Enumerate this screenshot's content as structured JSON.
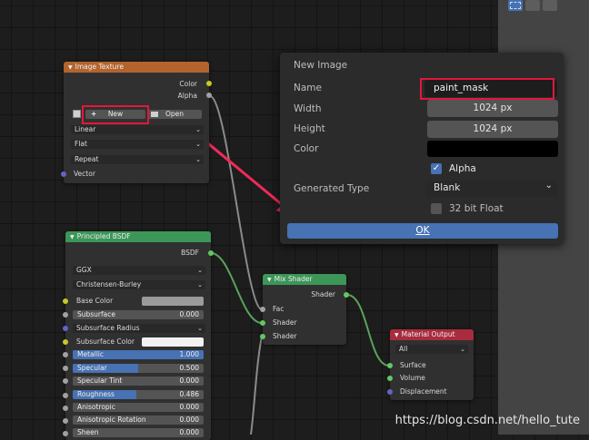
{
  "toolbar": {
    "tool_icons": [
      "select-box-icon",
      "extend-selection-icon",
      "subtract-selection-icon"
    ]
  },
  "image_texture": {
    "title": "Image Texture",
    "color_out": "Color",
    "alpha_out": "Alpha",
    "new_button": "New",
    "open_button": "Open",
    "interpolation": "Linear",
    "projection": "Flat",
    "extension": "Repeat",
    "vector_in": "Vector"
  },
  "principled": {
    "title": "Principled BSDF",
    "bsdf_out": "BSDF",
    "distribution": "GGX",
    "subsurface_method": "Christensen-Burley",
    "rows": [
      {
        "label": "Base Color",
        "value": ""
      },
      {
        "label": "Subsurface",
        "value": "0.000"
      },
      {
        "label": "Subsurface Radius",
        "value": ""
      },
      {
        "label": "Subsurface Color",
        "value": ""
      },
      {
        "label": "Metallic",
        "value": "1.000",
        "fill": 1.0
      },
      {
        "label": "Specular",
        "value": "0.500",
        "fill": 0.5
      },
      {
        "label": "Specular Tint",
        "value": "0.000",
        "fill": 0.0
      },
      {
        "label": "Roughness",
        "value": "0.486",
        "fill": 0.486
      },
      {
        "label": "Anisotropic",
        "value": "0.000"
      },
      {
        "label": "Anisotropic Rotation",
        "value": "0.000"
      },
      {
        "label": "Sheen",
        "value": "0.000"
      }
    ]
  },
  "mix_shader": {
    "title": "Mix Shader",
    "shader_out": "Shader",
    "fac": "Fac",
    "shader_in1": "Shader",
    "shader_in2": "Shader"
  },
  "material_output": {
    "title": "Material Output",
    "target": "All",
    "surface": "Surface",
    "volume": "Volume",
    "displacement": "Displacement"
  },
  "new_image_dialog": {
    "title": "New Image",
    "name_label": "Name",
    "name_value": "paint_mask",
    "width_label": "Width",
    "width_value": "1024 px",
    "height_label": "Height",
    "height_value": "1024 px",
    "color_label": "Color",
    "color_value": "#000000",
    "alpha_label": "Alpha",
    "alpha_checked": true,
    "generated_type_label": "Generated Type",
    "generated_type_value": "Blank",
    "float_label": "32 bit Float",
    "float_checked": false,
    "ok_button": "OK"
  },
  "watermark": "https://blog.csdn.net/hello_tute",
  "colors": {
    "texture_header": "#b3642e",
    "shader_header": "#3b9658",
    "output_header": "#a82c3c",
    "accent": "#4772b3",
    "annotation_red": "#e3163d"
  }
}
